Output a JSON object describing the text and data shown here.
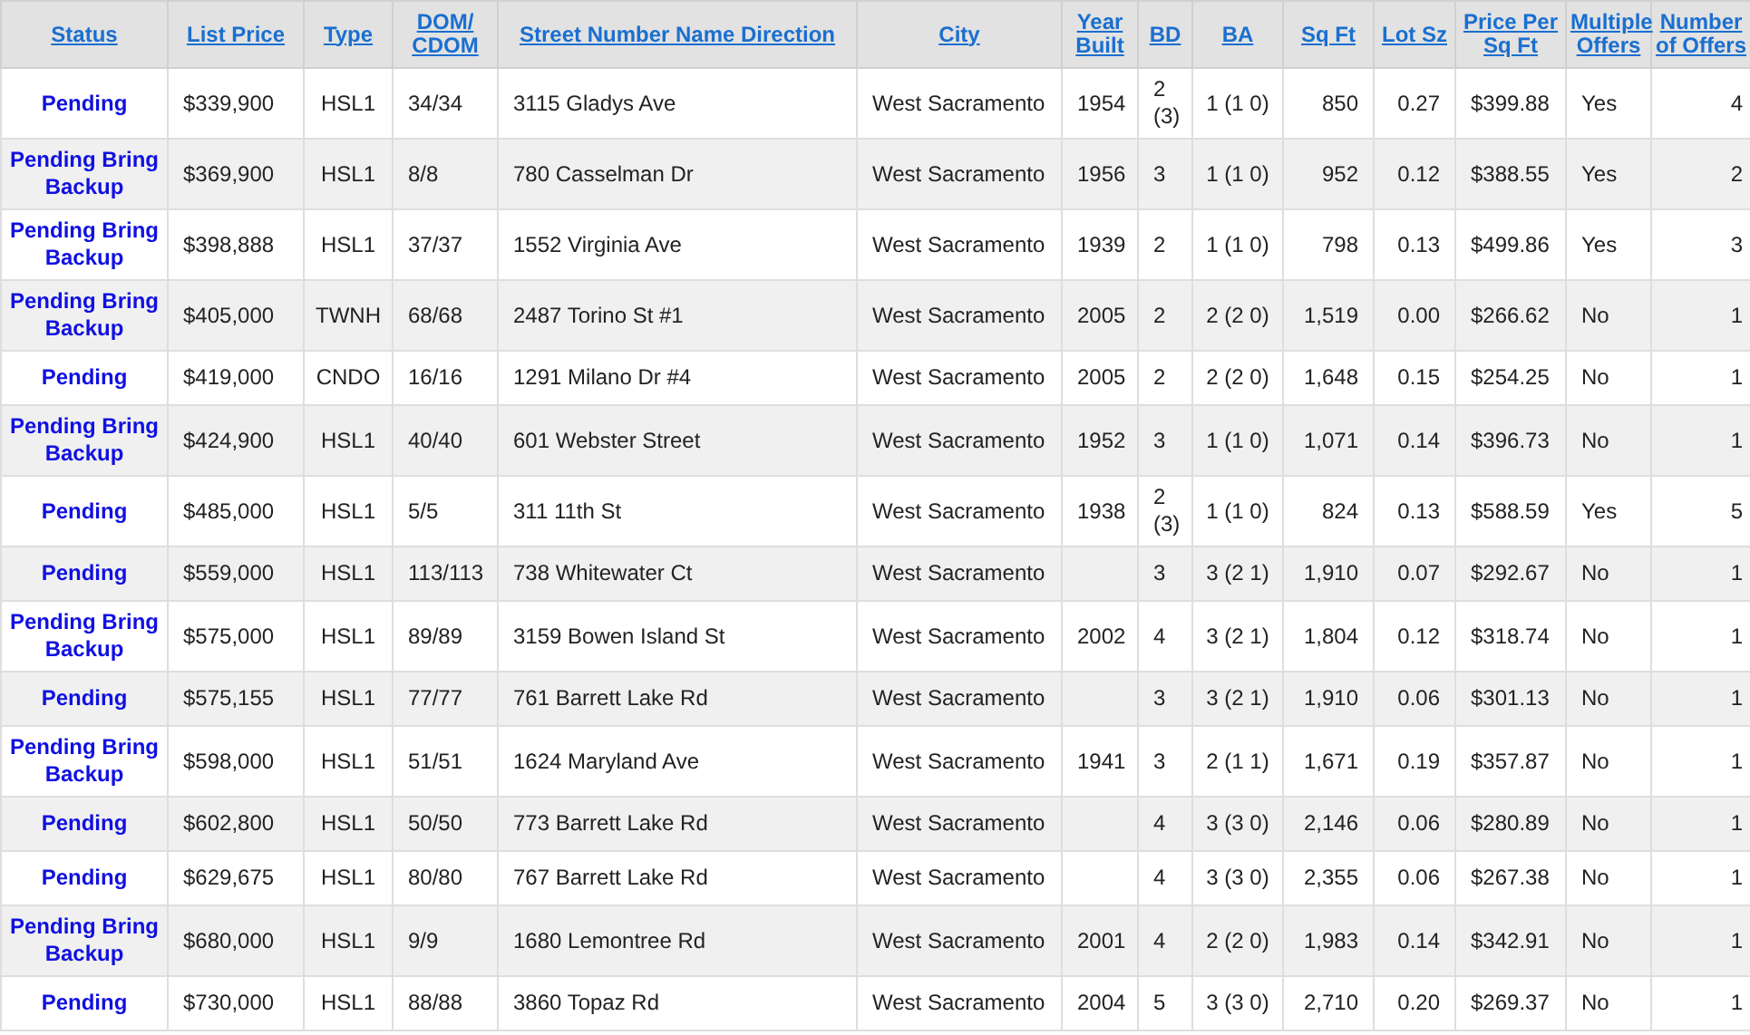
{
  "table": {
    "columns": [
      "Status",
      "List Price",
      "Type",
      "DOM/ CDOM",
      "Street Number Name Direction",
      "City",
      "Year Built",
      "BD",
      "BA",
      "Sq Ft",
      "Lot Sz",
      "Price Per Sq Ft",
      "Multiple Offers",
      "Number of Offers"
    ],
    "rows": [
      [
        "Pending",
        "$339,900",
        "HSL1",
        "34/34",
        "3115 Gladys Ave",
        "West Sacramento",
        "1954",
        "2 (3)",
        "1 (1 0)",
        "850",
        "0.27",
        "$399.88",
        "Yes",
        "4"
      ],
      [
        "Pending Bring Backup",
        "$369,900",
        "HSL1",
        "8/8",
        "780 Casselman Dr",
        "West Sacramento",
        "1956",
        "3",
        "1 (1 0)",
        "952",
        "0.12",
        "$388.55",
        "Yes",
        "2"
      ],
      [
        "Pending Bring Backup",
        "$398,888",
        "HSL1",
        "37/37",
        "1552 Virginia Ave",
        "West Sacramento",
        "1939",
        "2",
        "1 (1 0)",
        "798",
        "0.13",
        "$499.86",
        "Yes",
        "3"
      ],
      [
        "Pending Bring Backup",
        "$405,000",
        "TWNH",
        "68/68",
        "2487 Torino St #1",
        "West Sacramento",
        "2005",
        "2",
        "2 (2 0)",
        "1,519",
        "0.00",
        "$266.62",
        "No",
        "1"
      ],
      [
        "Pending",
        "$419,000",
        "CNDO",
        "16/16",
        "1291 Milano Dr #4",
        "West Sacramento",
        "2005",
        "2",
        "2 (2 0)",
        "1,648",
        "0.15",
        "$254.25",
        "No",
        "1"
      ],
      [
        "Pending Bring Backup",
        "$424,900",
        "HSL1",
        "40/40",
        "601 Webster Street",
        "West Sacramento",
        "1952",
        "3",
        "1 (1 0)",
        "1,071",
        "0.14",
        "$396.73",
        "No",
        "1"
      ],
      [
        "Pending",
        "$485,000",
        "HSL1",
        "5/5",
        "311 11th St",
        "West Sacramento",
        "1938",
        "2 (3)",
        "1 (1 0)",
        "824",
        "0.13",
        "$588.59",
        "Yes",
        "5"
      ],
      [
        "Pending",
        "$559,000",
        "HSL1",
        "113/113",
        "738 Whitewater Ct",
        "West Sacramento",
        "",
        "3",
        "3 (2 1)",
        "1,910",
        "0.07",
        "$292.67",
        "No",
        "1"
      ],
      [
        "Pending Bring Backup",
        "$575,000",
        "HSL1",
        "89/89",
        "3159 Bowen Island St",
        "West Sacramento",
        "2002",
        "4",
        "3 (2 1)",
        "1,804",
        "0.12",
        "$318.74",
        "No",
        "1"
      ],
      [
        "Pending",
        "$575,155",
        "HSL1",
        "77/77",
        "761 Barrett Lake Rd",
        "West Sacramento",
        "",
        "3",
        "3 (2 1)",
        "1,910",
        "0.06",
        "$301.13",
        "No",
        "1"
      ],
      [
        "Pending Bring Backup",
        "$598,000",
        "HSL1",
        "51/51",
        "1624 Maryland Ave",
        "West Sacramento",
        "1941",
        "3",
        "2 (1 1)",
        "1,671",
        "0.19",
        "$357.87",
        "No",
        "1"
      ],
      [
        "Pending",
        "$602,800",
        "HSL1",
        "50/50",
        "773 Barrett Lake Rd",
        "West Sacramento",
        "",
        "4",
        "3 (3 0)",
        "2,146",
        "0.06",
        "$280.89",
        "No",
        "1"
      ],
      [
        "Pending",
        "$629,675",
        "HSL1",
        "80/80",
        "767 Barrett Lake Rd",
        "West Sacramento",
        "",
        "4",
        "3 (3 0)",
        "2,355",
        "0.06",
        "$267.38",
        "No",
        "1"
      ],
      [
        "Pending Bring Backup",
        "$680,000",
        "HSL1",
        "9/9",
        "1680 Lemontree Rd",
        "West Sacramento",
        "2001",
        "4",
        "2 (2 0)",
        "1,983",
        "0.14",
        "$342.91",
        "No",
        "1"
      ],
      [
        "Pending",
        "$730,000",
        "HSL1",
        "88/88",
        "3860 Topaz Rd",
        "West Sacramento",
        "2004",
        "5",
        "3 (3 0)",
        "2,710",
        "0.20",
        "$269.37",
        "No",
        "1"
      ]
    ]
  }
}
